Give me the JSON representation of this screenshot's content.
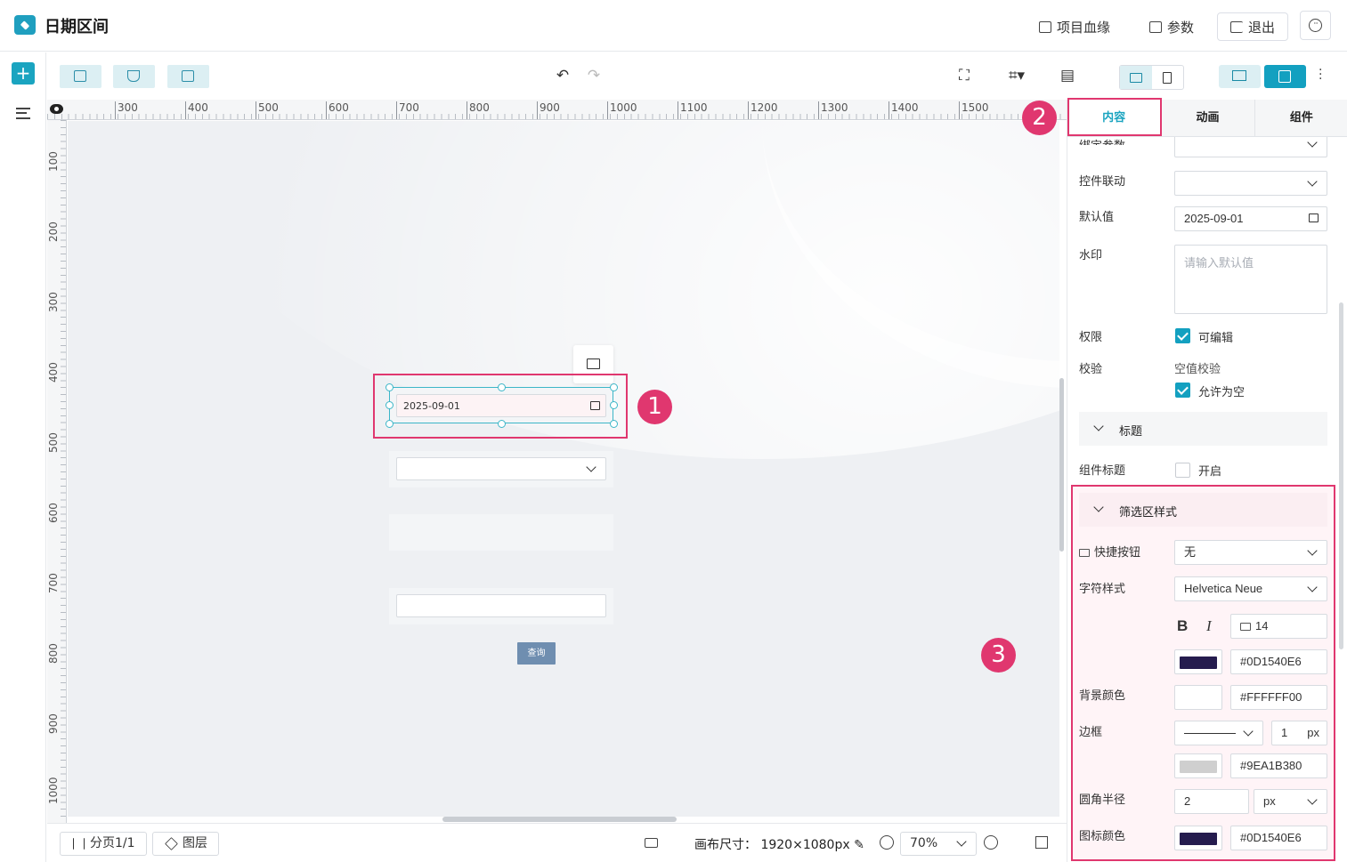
{
  "header": {
    "title": "日期区间",
    "lineage_label": "项目血缘",
    "params_label": "参数",
    "exit_label": "退出"
  },
  "toolbar": {
    "undo_icon": "undo-icon",
    "redo_icon": "redo-icon"
  },
  "ruler": {
    "top_ticks": [
      "300",
      "400",
      "500",
      "600",
      "700",
      "800",
      "900",
      "1000",
      "1100",
      "1200",
      "1300",
      "1400",
      "1500"
    ],
    "left_ticks": [
      "100",
      "200",
      "300",
      "400",
      "500",
      "600",
      "700",
      "800",
      "900",
      "1000"
    ]
  },
  "canvas": {
    "date_value": "2025-09-01",
    "query_label": "查询"
  },
  "annotations": {
    "badge1": "1",
    "badge2": "2",
    "badge3": "3"
  },
  "bottom": {
    "page_label": "分页1/1",
    "layer_label": "图层",
    "canvas_size_label": "画布尺寸：",
    "canvas_size_value": "1920×1080px",
    "zoom": "70%"
  },
  "panel": {
    "tabs": [
      "内容",
      "动画",
      "组件"
    ],
    "bind_param_label": "绑定参数",
    "linkage_label": "控件联动",
    "default_label": "默认值",
    "default_value": "2025-09-01",
    "watermark_label": "水印",
    "watermark_placeholder": "请输入默认值",
    "permission_label": "权限",
    "editable_label": "可编辑",
    "validate_label": "校验",
    "null_check_label": "空值校验",
    "allow_empty_label": "允许为空",
    "title_section": "标题",
    "comp_title_label": "组件标题",
    "comp_title_toggle": "开启",
    "filter_section": "筛选区样式",
    "quick_btn_label": "快捷按钮",
    "quick_btn_value": "无",
    "font_style_label": "字符样式",
    "font_value": "Helvetica Neue",
    "bold": "B",
    "italic": "I",
    "font_size": "14",
    "font_color": "#0D1540E6",
    "bg_color_label": "背景颜色",
    "bg_color": "#FFFFFF00",
    "border_label": "边框",
    "border_width": "1",
    "border_unit": "px",
    "border_color": "#9EA1B380",
    "radius_label": "圆角半径",
    "radius_value": "2",
    "radius_unit": "px",
    "icon_color_label": "图标颜色",
    "icon_color": "#0D1540E6"
  },
  "colors": {
    "accent": "#13a0c0",
    "highlight": "#e0376f",
    "font_swatch": "#251c4e",
    "border_swatch": "#cfcfcf"
  }
}
